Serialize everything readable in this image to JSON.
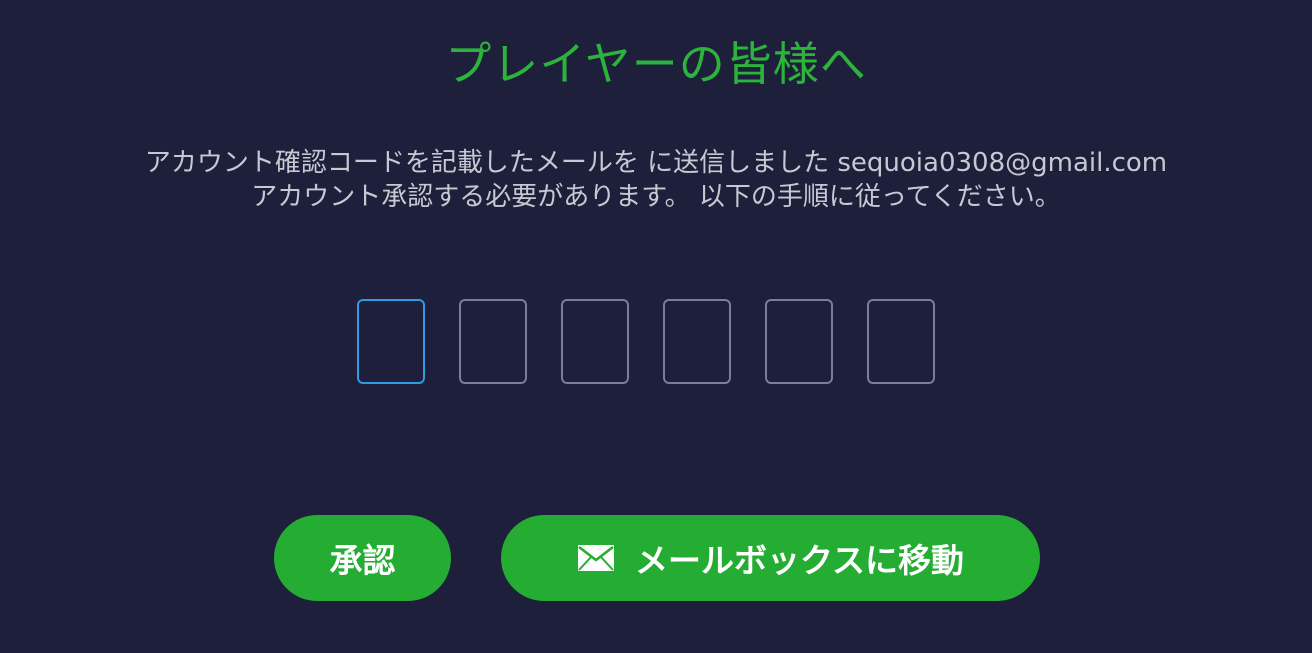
{
  "title": "プレイヤーの皆様へ",
  "message": {
    "line1": "アカウント確認コードを記載したメールを に送信しました sequoia0308@gmail.com",
    "line2": "アカウント承認する必要があります。 以下の手順に従ってください。"
  },
  "code": {
    "digits": [
      "",
      "",
      "",
      "",
      "",
      ""
    ],
    "active_index": 0
  },
  "buttons": {
    "approve_label": "承認",
    "mailbox_label": "メールボックスに移動",
    "mailbox_icon": "envelope-icon"
  },
  "colors": {
    "background": "#1d1f3b",
    "accent_green": "#25ad33",
    "title_green": "#2bb33b",
    "active_border": "#2f9be0",
    "inactive_border": "#7b7e98",
    "body_text": "#c7c8d2"
  }
}
